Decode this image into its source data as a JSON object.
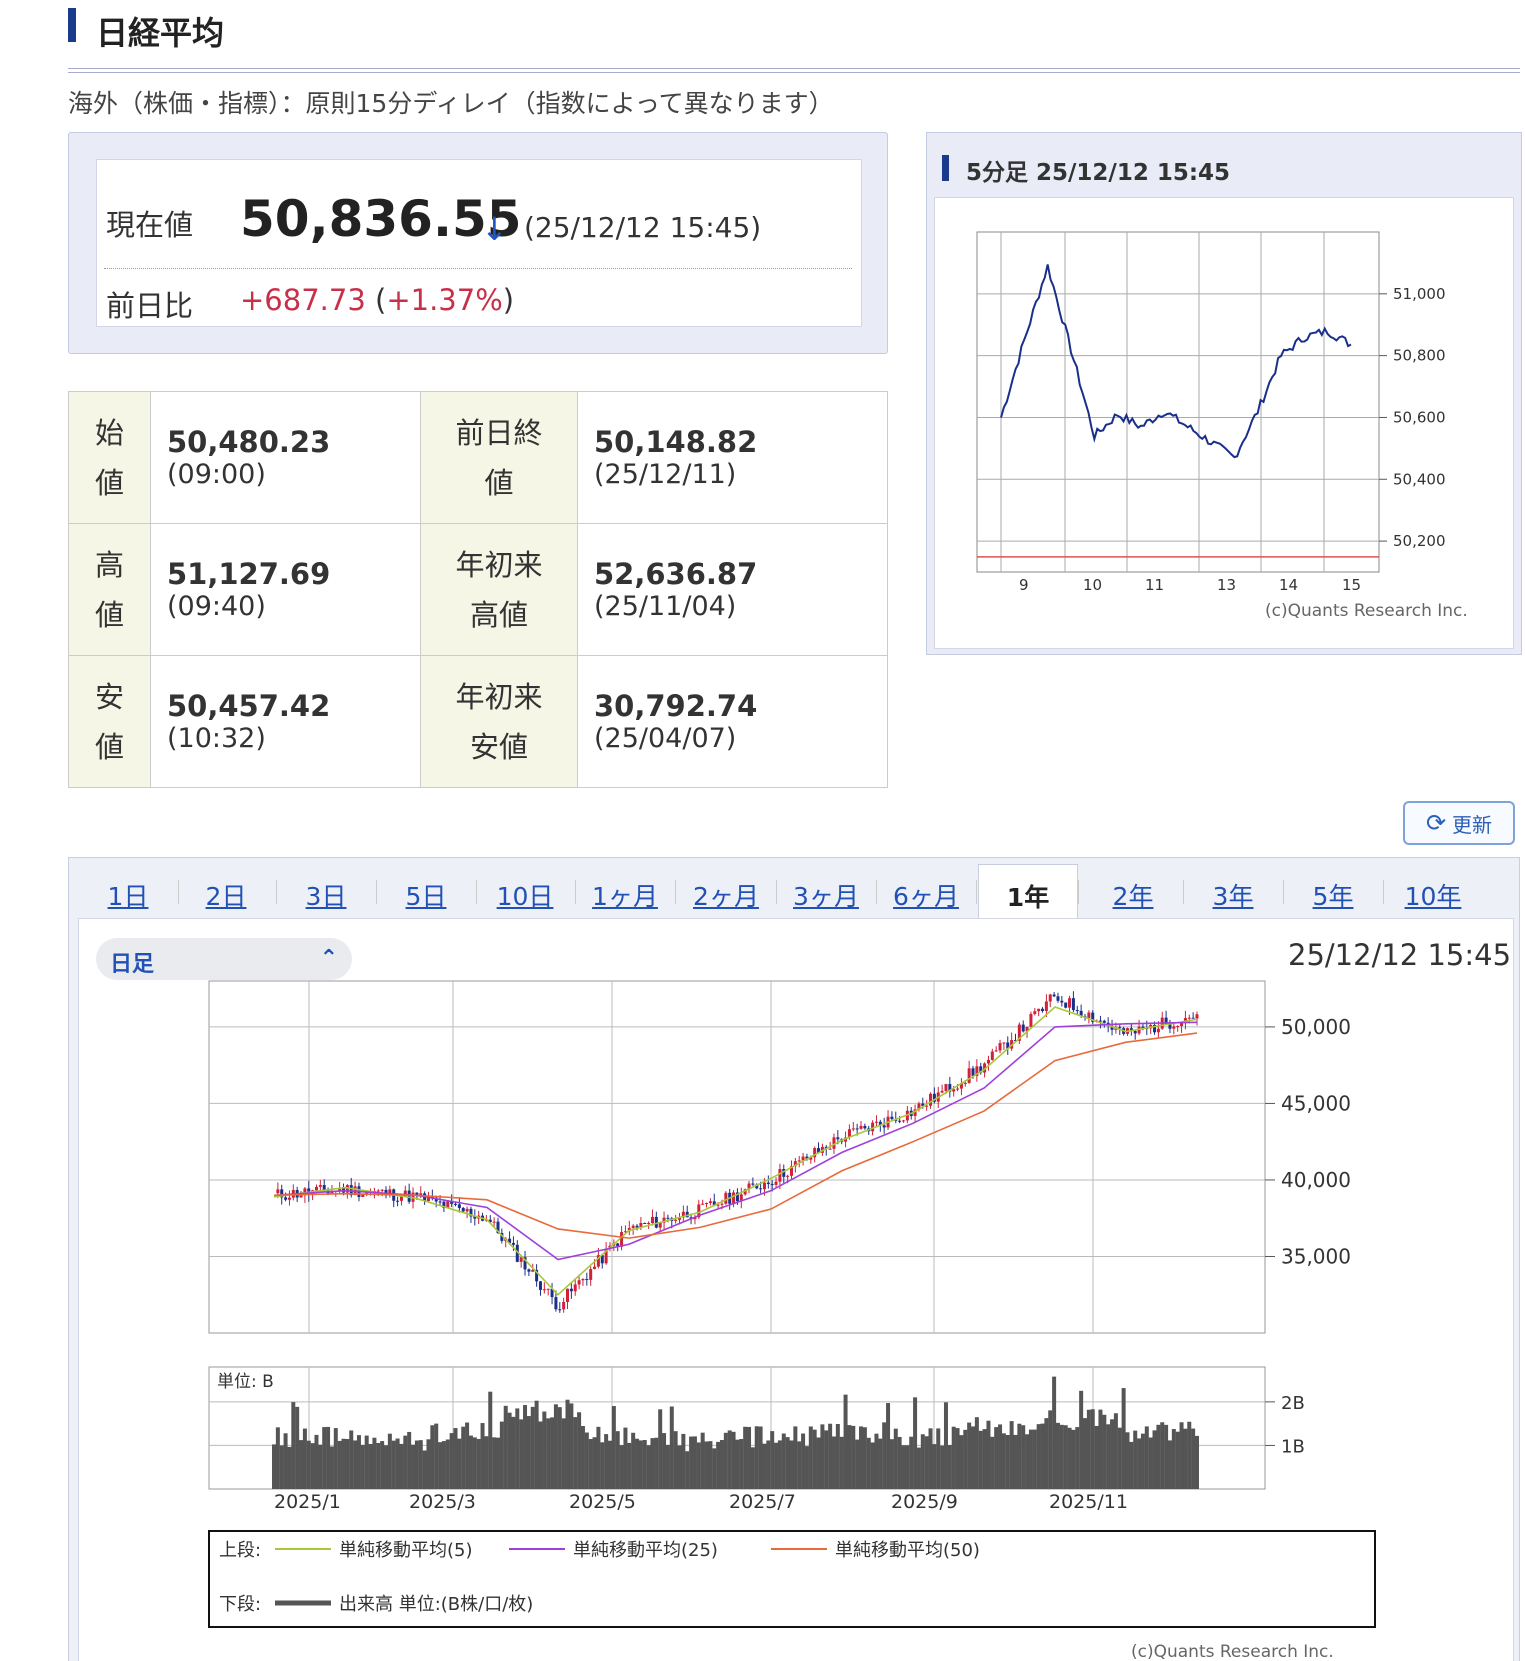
{
  "header": {
    "title": "日経平均",
    "notice": "海外（株価・指標）：原則15分ディレイ（指数によって異なります）"
  },
  "quote": {
    "current_label": "現在値",
    "current_value": "50,836.55",
    "arrow": "↓",
    "current_time": "(25/12/12 15:45)",
    "change_label": "前日比",
    "change_value": "+687.73",
    "change_pct": "+1.37%",
    "change_open": "(",
    "change_close": ")"
  },
  "stats": {
    "open": {
      "label1": "始",
      "label2": "値",
      "value": "50,480.23",
      "time": "(09:00)"
    },
    "prev_close": {
      "label1": "前日終",
      "label2": "値",
      "value": "50,148.82",
      "time": "(25/12/11)"
    },
    "high": {
      "label1": "高",
      "label2": "値",
      "value": "51,127.69",
      "time": "(09:40)"
    },
    "ytd_high": {
      "label1": "年初来",
      "label2": "高値",
      "value": "52,636.87",
      "time": "(25/11/04)"
    },
    "low": {
      "label1": "安",
      "label2": "値",
      "value": "50,457.42",
      "time": "(10:32)"
    },
    "ytd_low": {
      "label1": "年初来",
      "label2": "安値",
      "value": "30,792.74",
      "time": "(25/04/07)"
    }
  },
  "intraday": {
    "title": "5分足 25/12/12 15:45",
    "credit": "(c)Quants Research Inc."
  },
  "update_button": "更新",
  "tabs": [
    "1日",
    "2日",
    "3日",
    "5日",
    "10日",
    "1ヶ月",
    "2ヶ月",
    "3ヶ月",
    "6ヶ月",
    "1年",
    "2年",
    "3年",
    "5年",
    "10年"
  ],
  "active_tab": "1年",
  "main_chart": {
    "period_select": "日足",
    "timestamp": "25/12/12 15:45",
    "volume_unit_label": "単位: B",
    "legend": {
      "upper_label": "上段:",
      "lower_label": "下段:",
      "ma5": "単純移動平均(5)",
      "ma25": "単純移動平均(25)",
      "ma50": "単純移動平均(50)",
      "volume": "出来高 単位:(B株/口/枚)"
    },
    "credit": "(c)Quants Research Inc."
  },
  "colors": {
    "accent": "#1a3a8c",
    "up": "#d0203a",
    "down": "#1a2f8c",
    "ma5": "#a8c83a",
    "ma25": "#a040d8",
    "ma50": "#e86a3a",
    "link": "#2151b5"
  },
  "chart_data": [
    {
      "type": "line",
      "title": "5分足 25/12/12 15:45",
      "x": [
        "9:00",
        "9:20",
        "9:40",
        "10:00",
        "10:30",
        "11:00",
        "11:30",
        "12:30",
        "13:00",
        "13:30",
        "14:00",
        "14:30",
        "15:00",
        "15:15",
        "15:30",
        "15:45"
      ],
      "y": [
        50600,
        50850,
        51090,
        50820,
        50540,
        50610,
        50570,
        50620,
        50570,
        50520,
        50470,
        50620,
        50800,
        50860,
        50880,
        50836
      ],
      "xticks": [
        "9",
        "10",
        "11",
        "13",
        "14",
        "15"
      ],
      "yticks": [
        "50,200",
        "50,400",
        "50,600",
        "50,800",
        "51,000"
      ],
      "ylim": [
        50100,
        51200
      ],
      "reference_line": 50148.82
    },
    {
      "type": "candlestick",
      "title": "日足",
      "x": [
        "2024-12-19",
        "2025-01",
        "2025-02",
        "2025-03",
        "2025-04-07",
        "2025-05",
        "2025-06",
        "2025-07",
        "2025-08",
        "2025-09",
        "2025-10",
        "2025-11-04",
        "2025-11",
        "2025-12-12"
      ],
      "close": [
        39000,
        39400,
        38900,
        37500,
        31800,
        36800,
        38000,
        40000,
        42800,
        44500,
        47500,
        52000,
        49500,
        50837
      ],
      "series": [
        {
          "name": "単純移動平均(5)",
          "values": [
            38900,
            39500,
            38800,
            37400,
            32500,
            36700,
            37900,
            40100,
            42600,
            44400,
            47200,
            51300,
            49700,
            50500
          ]
        },
        {
          "name": "単純移動平均(25)",
          "values": [
            39000,
            39300,
            39000,
            38200,
            34800,
            35800,
            37700,
            39300,
            41800,
            43700,
            46000,
            50000,
            50200,
            50300
          ]
        },
        {
          "name": "単純移動平均(50)",
          "values": [
            39000,
            39100,
            39000,
            38700,
            36800,
            36200,
            36900,
            38100,
            40600,
            42500,
            44500,
            47800,
            49000,
            49600
          ]
        }
      ],
      "yticks": [
        "35,000",
        "40,000",
        "45,000",
        "50,000"
      ],
      "ylim": [
        30000,
        53000
      ],
      "xticks": [
        "2025/1",
        "2025/3",
        "2025/5",
        "2025/7",
        "2025/9",
        "2025/11"
      ]
    },
    {
      "type": "bar",
      "title": "出来高",
      "x": [
        "2025-01",
        "2025-02",
        "2025-03",
        "2025-04",
        "2025-05",
        "2025-06",
        "2025-07",
        "2025-08",
        "2025-09",
        "2025-10",
        "2025-11",
        "2025-12"
      ],
      "values": [
        1.2,
        1.1,
        1.3,
        1.8,
        1.2,
        1.1,
        1.2,
        1.3,
        1.2,
        1.4,
        1.6,
        1.3
      ],
      "yticks": [
        "1B",
        "2B"
      ],
      "ylim": [
        0,
        2.8
      ]
    }
  ]
}
